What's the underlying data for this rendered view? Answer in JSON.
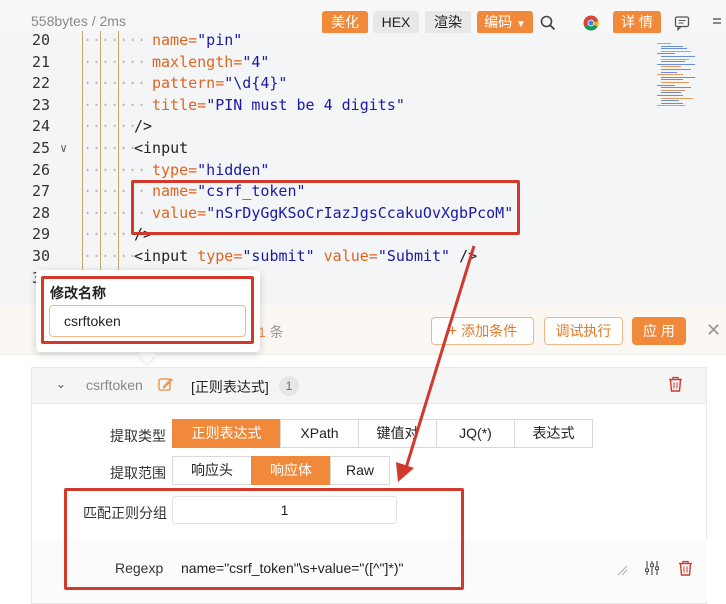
{
  "toolbar": {
    "size_label": "558bytes / 2ms",
    "beautify": "美化",
    "hex": "HEX",
    "render": "渲染",
    "encoding": "编码",
    "details": "详 情"
  },
  "editor": {
    "lines": [
      {
        "n": "20",
        "pre": "name=",
        "val": "\"pin\""
      },
      {
        "n": "21",
        "pre": "maxlength=",
        "val": "\"4\""
      },
      {
        "n": "22",
        "pre": "pattern=",
        "val": "\"\\d{4}\""
      },
      {
        "n": "23",
        "pre": "title=",
        "val": "\"PIN must be 4 digits\""
      },
      {
        "n": "24",
        "tag": "/>"
      },
      {
        "n": "25",
        "tag": "<input"
      },
      {
        "n": "26",
        "pre": "type=",
        "val": "\"hidden\""
      },
      {
        "n": "27",
        "pre": "name=",
        "val": "\"csrf_token\""
      },
      {
        "n": "28",
        "pre": "value=",
        "val": "\"nSrDyGgKSoCrIazJgsCcakuOvXgbPcoM\""
      },
      {
        "n": "29",
        "tag": "/>"
      },
      {
        "n": "30",
        "tag": "<input",
        "pre": "type=",
        "val": "\"submit\"",
        "pre2": "value=",
        "val2": "\"Submit\"",
        "tail": "/>"
      },
      {
        "n": "31",
        "tag": ""
      }
    ]
  },
  "panel": {
    "count_prefix": "",
    "count_value": "1",
    "count_suffix": " 条",
    "add_condition": "添加条件",
    "debug_run": "调试执行",
    "apply": "应 用",
    "close": "✕"
  },
  "rule": {
    "name": "csrftoken",
    "type_label": "[正则表达式]",
    "count": "1",
    "extract_type_label": "提取类型",
    "extract_types": [
      "正则表达式",
      "XPath",
      "键值对",
      "JQ(*)",
      "表达式"
    ],
    "extract_type_selected": "正则表达式",
    "extract_scope_label": "提取范围",
    "extract_scopes": [
      "响应头",
      "响应体",
      "Raw"
    ],
    "extract_scope_selected": "响应体",
    "group_label": "匹配正则分组",
    "group_value": "1",
    "regexp_label": "Regexp",
    "regexp_value": "name=\"csrf_token\"\\s+value=\"([^\"]*)\""
  },
  "popover": {
    "title": "修改名称",
    "input_value": "csrftoken"
  },
  "colors": {
    "accent": "#f08a3a",
    "highlight": "#d0392b"
  }
}
